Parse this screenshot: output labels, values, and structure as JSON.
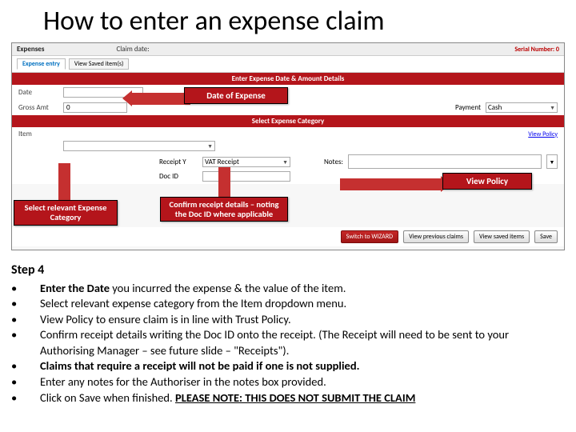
{
  "title": "How to enter an expense claim",
  "app": {
    "expenses_label": "Expenses",
    "claim_date_label": "Claim date:",
    "serial": "Serial Number: 0",
    "tabs": {
      "entry": "Expense entry",
      "saved": "View Saved item(s)"
    },
    "bar1": "Enter Expense Date & Amount Details",
    "date_label": "Date",
    "gross_label": "Gross Amt",
    "gross_value": "0",
    "payment_label": "Payment",
    "payment_value": "Cash",
    "bar2": "Select Expense Category",
    "item_label": "Item",
    "view_policy": "View Policy",
    "receipt_label": "Receipt Y",
    "receipt_value": "VAT Receipt",
    "docid_label": "Doc ID",
    "notes_label": "Notes:",
    "buttons": {
      "wizard": "Switch to WIZARD",
      "prev": "View previous claims",
      "saved": "View saved items",
      "save": "Save"
    }
  },
  "callouts": {
    "date": "Date of Expense",
    "policy": "View Policy",
    "category": "Select relevant Expense Category",
    "receipt": "Confirm receipt details – noting the Doc ID where applicable"
  },
  "steps": {
    "heading": "Step 4",
    "items": [
      "Enter the Date you incurred the expense & the value of the item.",
      "Select relevant expense category from the Item dropdown menu.",
      "View Policy to ensure claim is in line with Trust Policy.",
      "Confirm receipt details writing the Doc ID onto the receipt. (The Receipt will need to be sent to your Authorising Manager – see future slide – \"Receipts\").",
      "Claims that require a receipt will not be paid if one is not supplied.",
      "Enter any notes for the Authoriser in the notes box provided.",
      "Click on Save when finished. PLEASE NOTE: THIS DOES NOT SUBMIT THE CLAIM"
    ]
  }
}
